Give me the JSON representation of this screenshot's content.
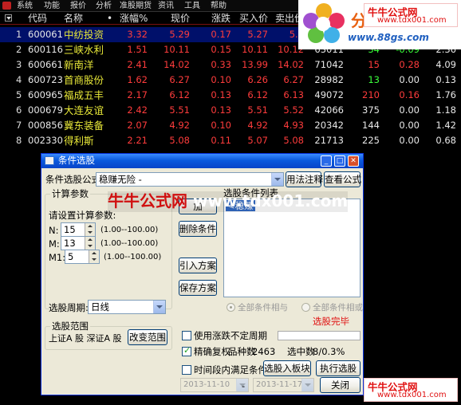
{
  "menu": [
    "系统",
    "功能",
    "报价",
    "分析",
    "准股期货",
    "资讯",
    "工具",
    "帮助"
  ],
  "grid": {
    "headers": [
      "代码",
      "名称",
      "•",
      "涨幅%",
      "现价",
      "涨跌",
      "买入价",
      "卖出价"
    ],
    "rows": [
      {
        "num": "1",
        "code": "600061",
        "name": "中纺投资",
        "chg": "3.32",
        "price": "5.29",
        "diff": "0.17",
        "bid": "5.27",
        "ask": "5.2",
        "vol": "",
        "cur": "",
        "spd": "",
        "turn": ""
      },
      {
        "num": "2",
        "code": "600116",
        "name": "三峡水利",
        "chg": "1.51",
        "price": "10.11",
        "diff": "0.15",
        "bid": "10.11",
        "ask": "10.12",
        "vol": "63011",
        "cur": "34",
        "spd": "-0.09",
        "turn": "2.36"
      },
      {
        "num": "3",
        "code": "600661",
        "name": "新南洋",
        "chg": "2.41",
        "price": "14.02",
        "diff": "0.33",
        "bid": "13.99",
        "ask": "14.02",
        "vol": "71042",
        "cur": "15",
        "spd": "0.28",
        "turn": "4.09"
      },
      {
        "num": "4",
        "code": "600723",
        "name": "首商股份",
        "chg": "1.62",
        "price": "6.27",
        "diff": "0.10",
        "bid": "6.26",
        "ask": "6.27",
        "vol": "28982",
        "cur": "13",
        "spd": "0.00",
        "turn": "0.13"
      },
      {
        "num": "5",
        "code": "600965",
        "name": "福成五丰",
        "chg": "2.17",
        "price": "6.12",
        "diff": "0.13",
        "bid": "6.12",
        "ask": "6.13",
        "vol": "49072",
        "cur": "210",
        "spd": "0.16",
        "turn": "1.76"
      },
      {
        "num": "6",
        "code": "000679",
        "name": "大连友谊",
        "chg": "2.42",
        "price": "5.51",
        "diff": "0.13",
        "bid": "5.51",
        "ask": "5.52",
        "vol": "42066",
        "cur": "375",
        "spd": "0.00",
        "turn": "1.18"
      },
      {
        "num": "7",
        "code": "000856",
        "name": "冀东装备",
        "chg": "2.07",
        "price": "4.92",
        "diff": "0.10",
        "bid": "4.92",
        "ask": "4.93",
        "vol": "20342",
        "cur": "144",
        "spd": "0.00",
        "turn": "1.42"
      },
      {
        "num": "8",
        "code": "002330",
        "name": "得利斯",
        "chg": "2.21",
        "price": "5.08",
        "diff": "0.11",
        "bid": "5.07",
        "ask": "5.08",
        "vol": "21713",
        "cur": "225",
        "spd": "0.00",
        "turn": "0.68"
      }
    ]
  },
  "logo": {
    "cn": "分",
    "url": "www.88gs.com"
  },
  "watermark": {
    "cn": "牛牛公式网",
    "url": "www.tdx001.com",
    "mid_cn": "牛牛公式网",
    "mid_url": "www.tdx001.com"
  },
  "dialog": {
    "title": "条件选股",
    "formula_label": "条件选股公式",
    "formula_value": "稳赚无险 -",
    "usage_button": "用法注释",
    "view_button": "查看公式",
    "params_group": "计算参数",
    "params_hint": "请设置计算参数:",
    "params": [
      {
        "name": "N:",
        "value": "15",
        "range": "(1.00--100.00)"
      },
      {
        "name": "M:",
        "value": "13",
        "range": "(1.00--100.00)"
      },
      {
        "name": "M1:",
        "value": "5",
        "range": "(1.00--100.00)"
      }
    ],
    "add_button": "加",
    "delete_button": "删除条件",
    "import_button": "引入方案",
    "save_button": "保存方案",
    "list_title": "选股条件列表",
    "list_item": "<稳赚",
    "period_label": "选股周期:",
    "period_value": "日线",
    "and_radio": "全部条件相与",
    "or_radio": "全部条件相或",
    "status": "选股完毕",
    "range_group": "选股范围",
    "range_value": "上证A 股 深证A 股",
    "change_range_button": "改变范围",
    "uncertain_period_label": "使用涨跌不定周期",
    "exact_rights_label": "精确复权",
    "stock_count_label": "品种数",
    "stock_count": "2463",
    "selected_label": "选中数",
    "selected_value": "8/0.3%",
    "time_range_label": "时间段内满足条件",
    "to_board_button": "选股入板块",
    "execute_button": "执行选股",
    "date_from": "2013-11-10",
    "date_sep": "-",
    "date_to": "2013-11-17",
    "close_button": "关闭"
  }
}
